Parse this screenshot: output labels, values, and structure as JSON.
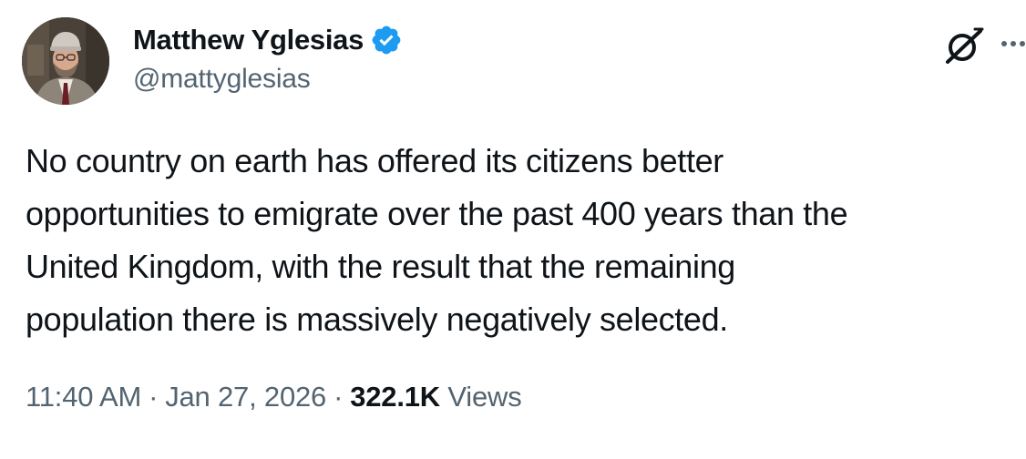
{
  "author": {
    "display_name": "Matthew Yglesias",
    "handle": "@mattyglesias",
    "verified": true,
    "verified_color": "#1d9bf0"
  },
  "tweet": {
    "text": "No country on earth has offered its citizens better\nopportunities to emigrate over the past 400 years than the\nUnited Kingdom, with the result that the remaining\npopulation there is massively negatively selected."
  },
  "meta": {
    "time": "11:40 AM",
    "separator": "·",
    "date": "Jan 27, 2026",
    "views_count": "322.1K",
    "views_label": "Views"
  },
  "icons": {
    "verified": "verified-badge-icon",
    "grok": "grok-icon",
    "more": "more-options-icon"
  },
  "colors": {
    "text_primary": "#0f1419",
    "text_secondary": "#536471",
    "accent": "#1d9bf0"
  }
}
